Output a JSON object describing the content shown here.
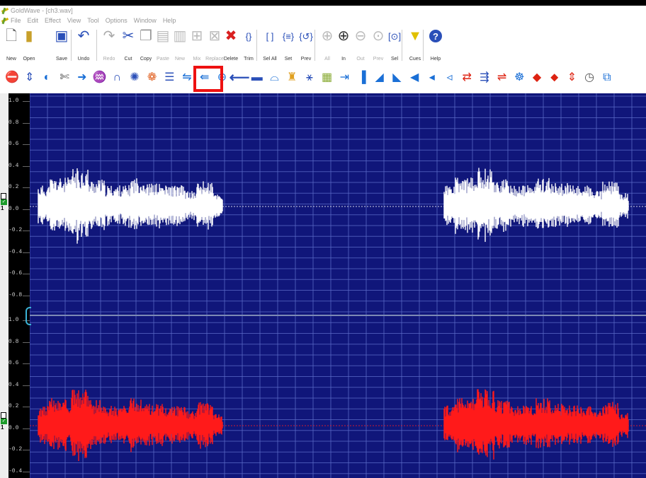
{
  "window": {
    "title": "GoldWave - [ch3.wav]"
  },
  "menu": [
    "File",
    "Edit",
    "Effect",
    "View",
    "Tool",
    "Options",
    "Window",
    "Help"
  ],
  "toolbar": [
    {
      "label": "New",
      "icon": "new-file-icon",
      "enabled": true
    },
    {
      "label": "Open",
      "icon": "open-folder-icon",
      "enabled": true
    },
    {
      "label": "Save",
      "icon": "save-disk-icon",
      "enabled": true
    },
    {
      "label": "Undo",
      "icon": "undo-icon",
      "enabled": true
    },
    {
      "label": "Redo",
      "icon": "redo-icon",
      "enabled": false
    },
    {
      "label": "Cut",
      "icon": "scissors-icon",
      "enabled": true
    },
    {
      "label": "Copy",
      "icon": "copy-icon",
      "enabled": true
    },
    {
      "label": "Paste",
      "icon": "paste-icon",
      "enabled": false
    },
    {
      "label": "New",
      "icon": "paste-new-icon",
      "enabled": false
    },
    {
      "label": "Mix",
      "icon": "mix-icon",
      "enabled": false
    },
    {
      "label": "Replace",
      "icon": "replace-icon",
      "enabled": false
    },
    {
      "label": "Delete",
      "icon": "delete-x-icon",
      "enabled": true
    },
    {
      "label": "Trim",
      "icon": "trim-icon",
      "enabled": true
    },
    {
      "label": "Sel All",
      "icon": "select-all-icon",
      "enabled": true
    },
    {
      "label": "Set",
      "icon": "set-selection-icon",
      "enabled": true
    },
    {
      "label": "Prev",
      "icon": "previous-selection-icon",
      "enabled": true
    },
    {
      "label": "All",
      "icon": "zoom-all-icon",
      "enabled": false
    },
    {
      "label": "In",
      "icon": "zoom-in-icon",
      "enabled": true
    },
    {
      "label": "Out",
      "icon": "zoom-out-icon",
      "enabled": false
    },
    {
      "label": "Prev",
      "icon": "zoom-previous-icon",
      "enabled": false
    },
    {
      "label": "Sel",
      "icon": "zoom-selection-icon",
      "enabled": true
    },
    {
      "label": "Cues",
      "icon": "cues-icon",
      "enabled": true
    },
    {
      "label": "Help",
      "icon": "help-icon",
      "enabled": true
    }
  ],
  "effects_toolbar_icons": [
    "stop-sign-icon",
    "compressor-icon",
    "doppler-icon",
    "dynamics-icon",
    "echo-icon",
    "equalizer-icon",
    "fade-icon",
    "filter-icon",
    "flanger-icon",
    "invert-icon",
    "mechanize-icon",
    "offset-icon",
    "pan-icon",
    "left-arrow-icon",
    "pitch-icon",
    "playback-rate-icon",
    "reverb-icon",
    "reverse-icon",
    "silence-icon",
    "spatial-icon",
    "time-warp-icon",
    "volume-icon",
    "auto-gain-icon",
    "change-volume-icon",
    "fade-in-icon",
    "fade-out-icon",
    "matcher-icon",
    "maximize-icon",
    "shape-volume-icon",
    "noise-reduction-icon",
    "pop-click-icon",
    "clip-fixer-icon",
    "interpolate-icon",
    "clock-icon",
    "channel-mixer-icon"
  ],
  "highlighted_icon": "left-arrow-icon",
  "ruler_top": [
    "1.0",
    "0.8",
    "0.6",
    "0.4",
    "0.2",
    "0.0",
    "-0.2",
    "-0.4",
    "-0.6",
    "-0.8"
  ],
  "ruler_bottom": [
    "1.0",
    "0.8",
    "0.6",
    "0.4",
    "0.2",
    "0.0",
    "-0.2",
    "-0.4"
  ],
  "channel_labels": [
    "1",
    "1"
  ],
  "colors": {
    "wave_background": "#10167a",
    "grid": "#5b6bc8",
    "left_channel": "#ffffff",
    "right_channel": "#ff1a1a",
    "highlight": "#e11111"
  }
}
